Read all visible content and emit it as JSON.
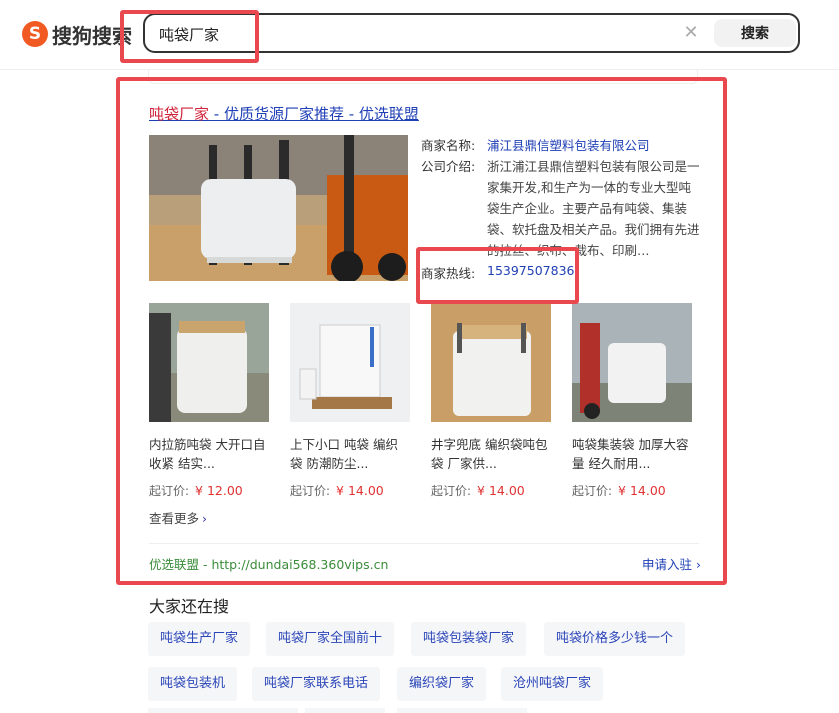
{
  "brand": {
    "logo_letter": "S",
    "name": "搜狗搜索"
  },
  "search": {
    "query": "吨袋厂家",
    "button_label": "搜索",
    "clear_glyph": "✕"
  },
  "ad": {
    "title_keyword": "吨袋厂家",
    "title_rest": " - 优质货源厂家推荐 - 优选联盟",
    "merchant_label": "商家名称:",
    "merchant_name": "浦江县鼎信塑料包装有限公司",
    "intro_label": "公司介绍:",
    "intro_text": "浙江浦江县鼎信塑料包装有限公司是一家集开发,和生产为一体的专业大型吨袋生产企业。主要产品有吨袋、集装袋、软托盘及相关产品。我们拥有先进的拉丝、织布、裁布、印刷…",
    "hotline_label": "商家热线:",
    "hotline": "15397507836",
    "products": [
      {
        "name": "内拉筋吨袋 大开口自收紧 结实...",
        "price_label": "起订价:",
        "price": "¥ 12.00"
      },
      {
        "name": "上下小口 吨袋 编织袋 防潮防尘...",
        "price_label": "起订价:",
        "price": "¥ 14.00"
      },
      {
        "name": "井字兜底 编织袋吨包袋 厂家供...",
        "price_label": "起订价:",
        "price": "¥ 14.00"
      },
      {
        "name": "吨袋集装袋 加厚大容量 经久耐用...",
        "price_label": "起订价:",
        "price": "¥ 14.00"
      }
    ],
    "see_more": "查看更多",
    "footer_source": "优选联盟 - http://dundai568.360vips.cn",
    "apply_label": "申请入驻"
  },
  "related": {
    "title": "大家还在搜",
    "tags": [
      "吨袋生产厂家",
      "吨袋厂家全国前十",
      "吨袋包装袋厂家",
      "吨袋价格多少钱一个",
      "吨袋包装机",
      "吨袋厂家联系电话",
      "编织袋厂家",
      "沧州吨袋厂家"
    ]
  },
  "colors": {
    "highlight": "#e9484f",
    "link": "#1f3fb5",
    "keyword": "#d0243a",
    "price": "#e03333",
    "url_green": "#3a8c3a",
    "brand": "#f15a22"
  }
}
